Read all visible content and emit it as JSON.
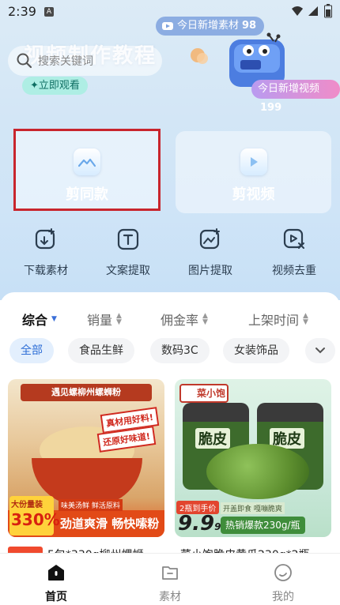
{
  "status_bar": {
    "time": "2:39",
    "notif_letter": "A"
  },
  "banner": {
    "title": "视频制作教程",
    "watch_label": "✦立即观看",
    "top_pill_text": "今日新增素材",
    "top_pill_count": "98",
    "bottom_pill_text": "今日新增视频",
    "bottom_pill_count": "199"
  },
  "search": {
    "placeholder": "搜索关键词"
  },
  "features": [
    {
      "label": "剪同款",
      "icon": "mountain-image-icon",
      "highlighted": true
    },
    {
      "label": "剪视频",
      "icon": "play-icon",
      "highlighted": false
    }
  ],
  "tools": [
    {
      "label": "下载素材",
      "icon": "download-material-icon"
    },
    {
      "label": "文案提取",
      "icon": "text-extract-icon"
    },
    {
      "label": "图片提取",
      "icon": "image-extract-icon"
    },
    {
      "label": "视频去重",
      "icon": "video-dedup-icon"
    }
  ],
  "sort": [
    {
      "label": "综合",
      "active": true
    },
    {
      "label": "销量",
      "active": false
    },
    {
      "label": "佣金率",
      "active": false
    },
    {
      "label": "上架时间",
      "active": false
    }
  ],
  "categories": [
    {
      "label": "全部",
      "active": true
    },
    {
      "label": "食品生鲜",
      "active": false
    },
    {
      "label": "数码3C",
      "active": false
    },
    {
      "label": "女装饰品",
      "active": false
    }
  ],
  "products": [
    {
      "image_banner": "遇见螺柳州螺蛳粉",
      "tag1": "真材用好料!",
      "tag2": "还原好味道!",
      "note": "味美汤鲜 鲜活原料",
      "price_small": "大份量装",
      "price": "330%",
      "slogan": "劲道爽滑 畅快嗦粉",
      "title": "5包*330g柳州螺蛳"
    },
    {
      "logo": "菜小饱",
      "jar_label": "脆皮",
      "price_tag": "2瓶到手价",
      "price": "9.9",
      "price_unit": "9",
      "sub_badge": "开盖即食 嘎嘣脆爽",
      "hot_label": "热销爆款230g/瓶",
      "title": "菜小饱脆皮黄瓜230g*2瓶"
    }
  ],
  "bottom_nav": [
    {
      "label": "首页",
      "icon": "home-icon",
      "active": true
    },
    {
      "label": "素材",
      "icon": "folder-icon",
      "active": false
    },
    {
      "label": "我的",
      "icon": "profile-icon",
      "active": false
    }
  ],
  "colors": {
    "accent_blue": "#2f6fd6",
    "highlight_red": "#c8252d",
    "teal_button": "#aeeee4",
    "pink_gradient_end": "#f08cc8"
  }
}
